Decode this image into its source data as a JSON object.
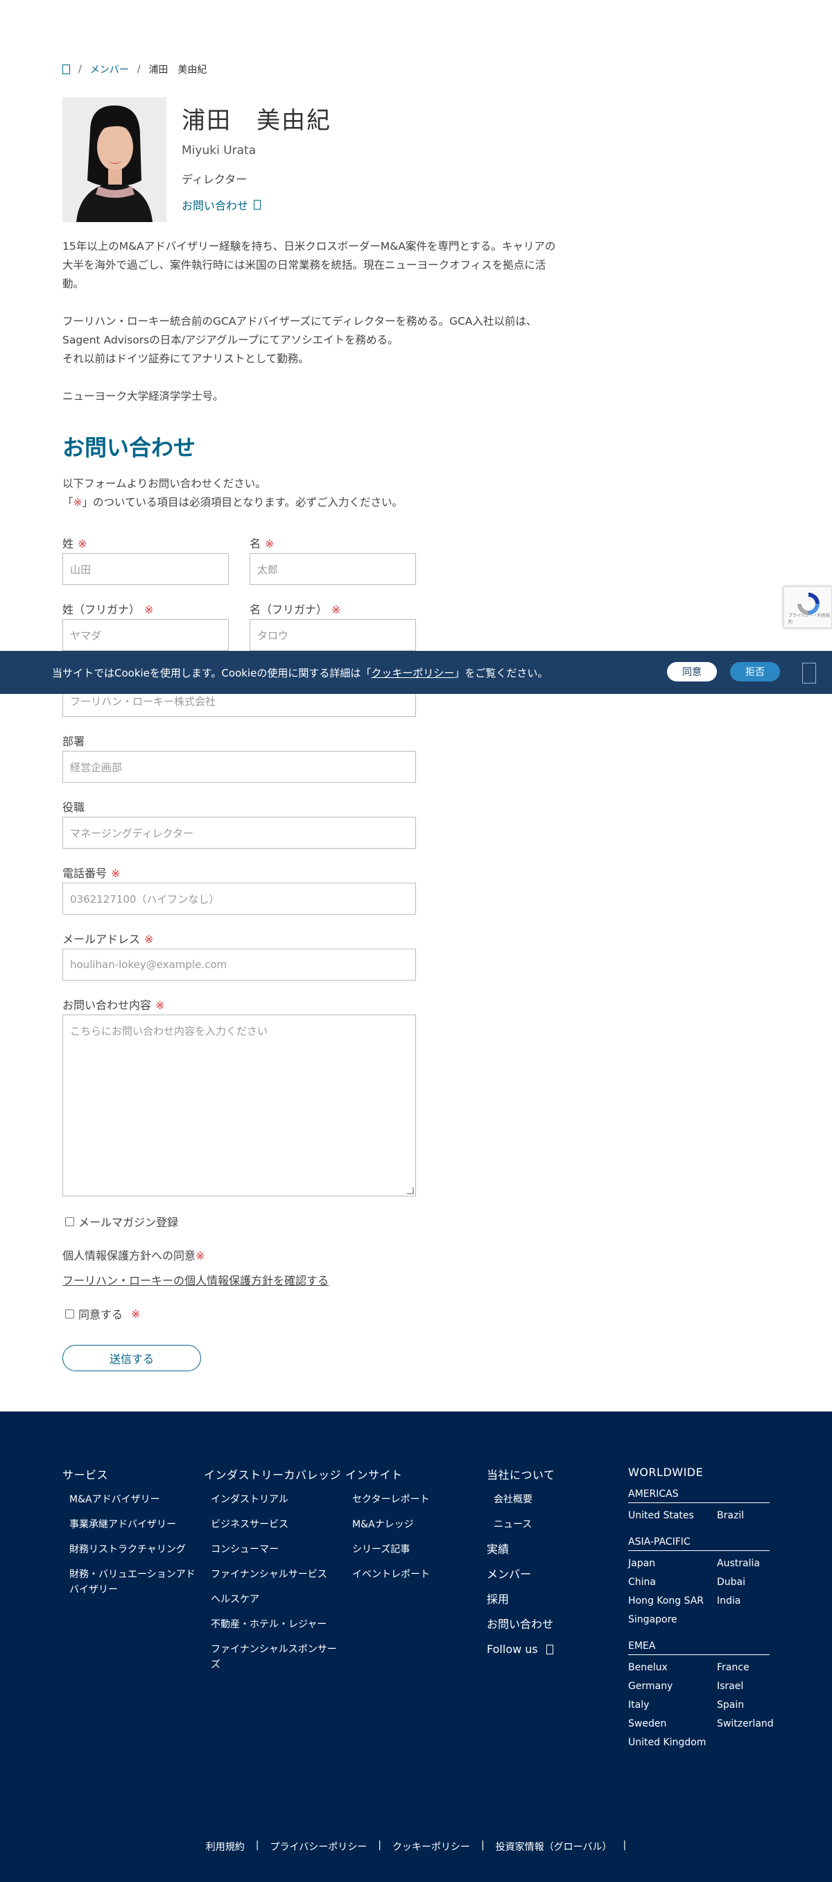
{
  "breadcrumb": {
    "members": "メンバー",
    "current": "浦田　美由紀",
    "sep": "/"
  },
  "profile": {
    "name_ja": "浦田　美由紀",
    "name_en": "Miyuki Urata",
    "role": "ディレクター",
    "contact_link": "お問い合わせ"
  },
  "bio": [
    "15年以上のM&Aアドバイザリー経験を持ち、日米クロスボーダーM&A案件を専門とする。キャリアの大半を海外で過ごし、案件執行時には米国の日常業務を統括。現在ニューヨークオフィスを拠点に活動。",
    "フーリハン・ローキー統合前のGCAアドバイザーズにてディレクターを務める。GCA入社以前は、Sagent Advisorsの日本/アジアグループにてアソシエイトを務める。",
    "それ以前はドイツ証券にてアナリストとして勤務。",
    "ニューヨーク大学経済学学士号。"
  ],
  "form": {
    "title": "お問い合わせ",
    "intro_line1": "以下フォームよりお問い合わせください。",
    "intro_line2_pre": "「",
    "intro_mark": "※",
    "intro_line2_post": "」のついている項目は必須項目となります。必ずご入力ください。",
    "required_mark": "※",
    "last_name": {
      "label": "姓",
      "placeholder": "山田"
    },
    "first_name": {
      "label": "名",
      "placeholder": "太郎"
    },
    "last_kana": {
      "label": "姓（フリガナ）",
      "placeholder": "ヤマダ"
    },
    "first_kana": {
      "label": "名（フリガナ）",
      "placeholder": "タロウ"
    },
    "company": {
      "placeholder": "フーリハン・ローキー株式会社"
    },
    "department": {
      "label": "部署",
      "placeholder": "経営企画部"
    },
    "position": {
      "label": "役職",
      "placeholder": "マネージングディレクター"
    },
    "phone": {
      "label": "電話番号",
      "placeholder": "0362127100（ハイフンなし）"
    },
    "email": {
      "label": "メールアドレス",
      "placeholder": "houlihan-lokey@example.com"
    },
    "message": {
      "label": "お問い合わせ内容",
      "placeholder": "こちらにお問い合わせ内容を入力ください"
    },
    "newsletter": "メールマガジン登録",
    "consent_title": "個人情報保護方針への同意",
    "privacy_link": "フーリハン・ローキーの個人情報保護方針を確認する",
    "agree": "同意する",
    "submit": "送信する"
  },
  "cookie": {
    "pre": "当サイトではCookieを使用します。Cookieの使用に関する詳細は「",
    "link": "クッキーポリシー",
    "post": "」をご覧ください。",
    "agree": "同意",
    "decline": "拒否"
  },
  "footer": {
    "services": {
      "title": "サービス",
      "items": [
        "M&Aアドバイザリー",
        "事業承継アドバイザリー",
        "財務リストラクチャリング",
        "財務・バリュエーションアドバイザリー"
      ]
    },
    "industry": {
      "title": "インダストリーカバレッジ",
      "items": [
        "インダストリアル",
        "ビジネスサービス",
        "コンシューマー",
        "ファイナンシャルサービス",
        "ヘルスケア",
        "不動産・ホテル・レジャー",
        "ファイナンシャルスポンサーズ"
      ]
    },
    "insight": {
      "title": "インサイト",
      "items": [
        "セクターレポート",
        "M&Aナレッジ",
        "シリーズ記事",
        "イベントレポート"
      ]
    },
    "company": {
      "title": "当社について",
      "items": [
        "会社概要",
        "ニュース"
      ],
      "main": [
        "実績",
        "メンバー",
        "採用",
        "お問い合わせ"
      ],
      "follow": "Follow us"
    },
    "worldwide": {
      "title": "WORLDWIDE",
      "americas": {
        "name": "AMERICAS",
        "countries": [
          "United States",
          "Brazil"
        ]
      },
      "apac": {
        "name": "ASIA-PACIFIC",
        "countries": [
          "Japan",
          "Australia",
          "China",
          "Dubai",
          "Hong Kong SAR",
          "India",
          "Singapore"
        ]
      },
      "emea": {
        "name": "EMEA",
        "countries": [
          "Benelux",
          "France",
          "Germany",
          "Israel",
          "Italy",
          "Spain",
          "Sweden",
          "Switzerland",
          "United Kingdom"
        ]
      }
    },
    "bottom_links": [
      "利用規約",
      "プライバシーポリシー",
      "クッキーポリシー",
      "投資家情報（グローバル）"
    ],
    "divider": "|"
  },
  "recaptcha": {
    "text": "プライバシー・利用規約"
  }
}
